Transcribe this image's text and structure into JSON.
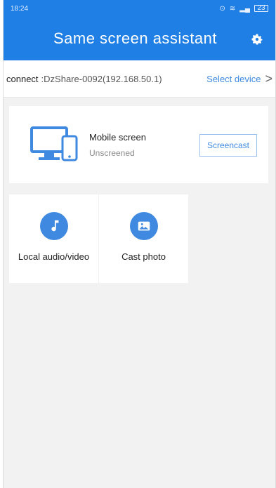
{
  "status_bar": {
    "time": "18:24",
    "battery": "23"
  },
  "header": {
    "title": "Same screen assistant",
    "settings_icon": "gear-icon",
    "color": "#1f7fe5"
  },
  "connection": {
    "label": "connect",
    "device": ":DzShare-0092(192.168.50.1)",
    "select_label": "Select device",
    "chevron": ">"
  },
  "screen_card": {
    "title": "Mobile screen",
    "status": "Unscreened",
    "button_label": "Screencast",
    "icon": "monitor-phone-icon"
  },
  "tiles": [
    {
      "label": "Local audio/video",
      "icon": "music-note-icon"
    },
    {
      "label": "Cast photo",
      "icon": "image-icon"
    }
  ]
}
